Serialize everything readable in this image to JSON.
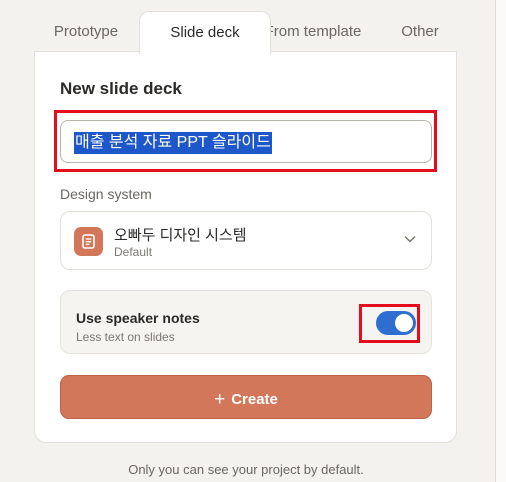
{
  "tabs": [
    {
      "label": "Prototype"
    },
    {
      "label": "Slide deck"
    },
    {
      "label": "From template"
    },
    {
      "label": "Other"
    }
  ],
  "active_tab": "Slide deck",
  "form": {
    "title": "New slide deck",
    "name_value": "매출 분석 자료 PPT 슬라이드",
    "design_system_label": "Design system",
    "design_system": {
      "name": "오빠두 디자인 시스템",
      "subtitle": "Default",
      "icon": "document-icon",
      "icon_color": "#d2775a"
    },
    "speaker_notes": {
      "title": "Use speaker notes",
      "subtitle": "Less text on slides",
      "enabled": true
    },
    "create_label": "Create",
    "create_icon": "plus-icon"
  },
  "footer_text": "Only you can see your project by default.",
  "colors": {
    "accent": "#d2775a",
    "toggle_on": "#2f6ed1",
    "selection": "#1d57c9",
    "annotation": "#e30d1b"
  }
}
